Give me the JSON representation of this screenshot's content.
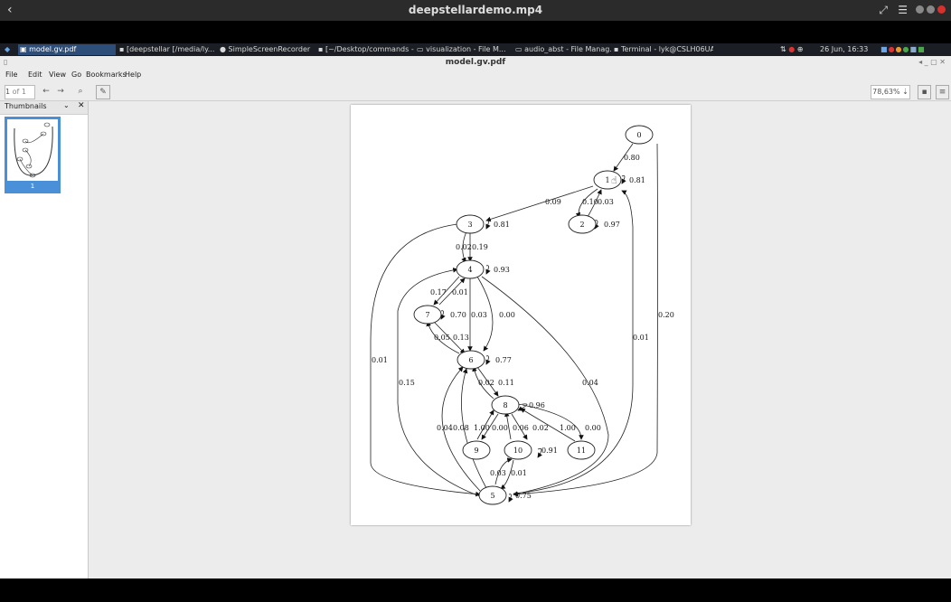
{
  "player": {
    "title": "deepstellardemo.mp4",
    "back_icon": "‹"
  },
  "taskbar": {
    "tasks": [
      "model.gv.pdf",
      "[deepstellar [/media/ly...",
      "SimpleScreenRecorder",
      "[~/Desktop/commands - S...",
      "visualization - File M...",
      "audio_abst - File Manag...",
      "Terminal - lyk@CSLH06UA..."
    ],
    "clock": "26 Jun, 16:33"
  },
  "app": {
    "title": "model.gv.pdf"
  },
  "menu": [
    "File",
    "Edit",
    "View",
    "Go",
    "Bookmarks",
    "Help"
  ],
  "toolbar": {
    "page_num": "1",
    "page_of": "of 1",
    "zoom": "78,63%"
  },
  "sidebar": {
    "title": "Thumbnails",
    "page_label": "1"
  },
  "graph": {
    "nodes": [
      "0",
      "1",
      "2",
      "3",
      "4",
      "7",
      "6",
      "8",
      "9",
      "10",
      "11",
      "5"
    ],
    "labels": [
      "0.80",
      "0.81",
      "0.09",
      "0.10",
      "0.03",
      "0.97",
      "0.81",
      "0.02",
      "0.19",
      "0.93",
      "0.17",
      "0.01",
      "0.70",
      "0.03",
      "0.00",
      "0.20",
      "0.01",
      "0.05",
      "0.13",
      "0.77",
      "0.01",
      "0.15",
      "0.02",
      "0.11",
      "0.04",
      "0.96",
      "0.04",
      "0.08",
      "1.00",
      "0.00",
      "0.06",
      "0.02",
      "1.00",
      "0.00",
      "0.91",
      "0.03",
      "0.01",
      "0.75"
    ]
  },
  "colors": {
    "accent": "#4a90d9",
    "taskbar": "#1b1e24"
  }
}
